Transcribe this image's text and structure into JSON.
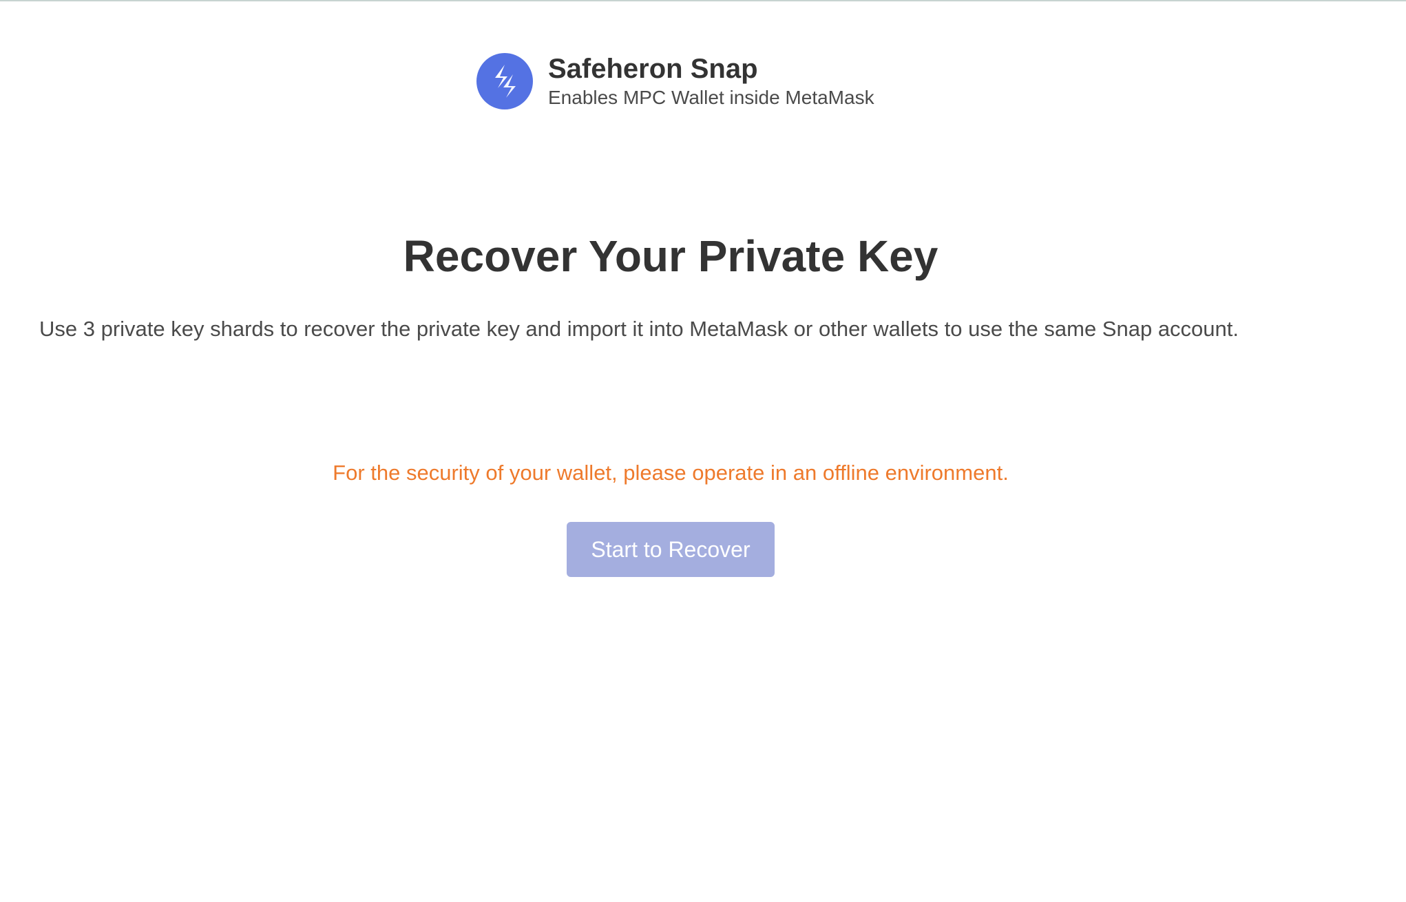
{
  "brand": {
    "name": "Safeheron Snap",
    "tagline": "Enables MPC Wallet inside MetaMask",
    "logo_icon": "safeheron-logo-icon",
    "logo_color": "#5472e3"
  },
  "main": {
    "title": "Recover Your Private Key",
    "description": "Use 3 private key shards to recover the private key and import it into MetaMask or other wallets to use the same Snap account.",
    "warning": "For the security of your wallet, please operate in an offline environment.",
    "warning_color": "#ee7a2c",
    "start_button_label": "Start to Recover",
    "start_button_color": "#a4aedf"
  }
}
